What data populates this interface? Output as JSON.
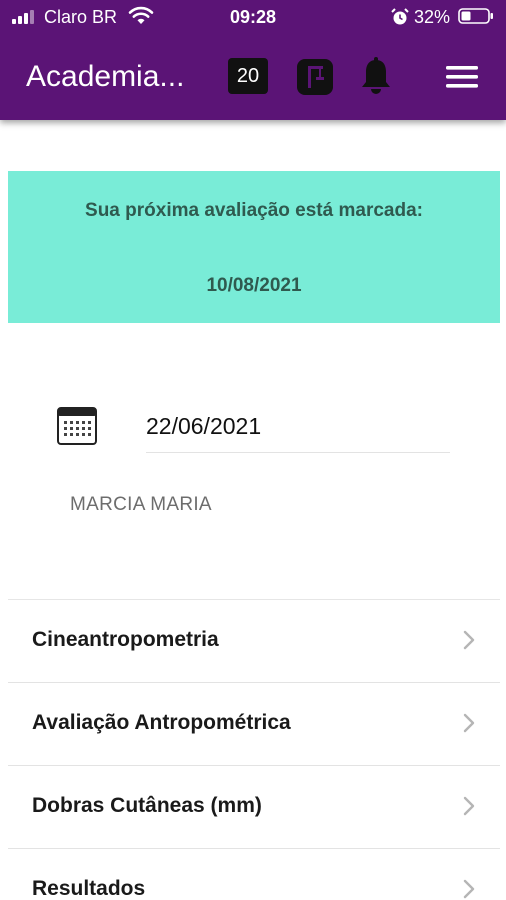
{
  "status_bar": {
    "carrier": "Claro BR",
    "time": "09:28",
    "battery_percent": "32%",
    "icons": [
      "signal-icon",
      "wifi-icon",
      "alarm-icon",
      "battery-icon"
    ]
  },
  "app_bar": {
    "title": "Academia...",
    "badge_count": "20",
    "icons": [
      "gym-icon",
      "bell-icon",
      "menu-icon"
    ],
    "background_color": "#5b1476"
  },
  "notice": {
    "title": "Sua próxima avaliação está marcada:",
    "date": "10/08/2021",
    "background_color": "#79ecd7"
  },
  "evaluation": {
    "date": "22/06/2021",
    "icon": "calendar-icon",
    "person_name": "MARCIA MARIA"
  },
  "menu_items": [
    {
      "label": "Cineantropometria"
    },
    {
      "label": "Avaliação Antropométrica"
    },
    {
      "label": "Dobras Cutâneas (mm)"
    },
    {
      "label": "Resultados"
    }
  ]
}
